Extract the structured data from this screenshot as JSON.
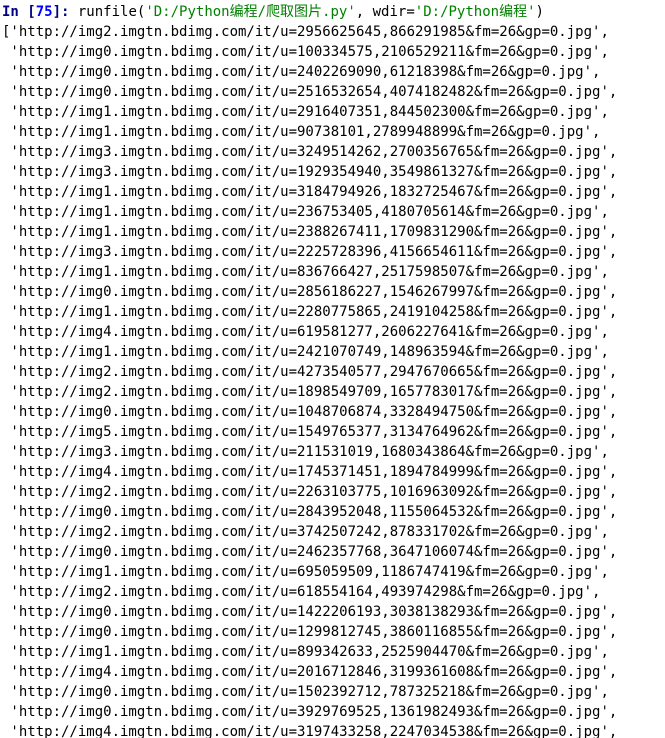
{
  "prompt": {
    "in_label_prefix": "In [",
    "in_number": "75",
    "in_label_suffix": "]: ",
    "func_name": "runfile",
    "open_paren": "(",
    "arg1": "'D:/Python编程/爬取图片.py'",
    "comma": ", ",
    "kwarg_name": "wdir",
    "equals": "=",
    "kwarg_val": "'D:/Python编程'",
    "close_paren": ")"
  },
  "urls": [
    "http://img2.imgtn.bdimg.com/it/u=2956625645,866291985&fm=26&gp=0.jpg",
    "http://img0.imgtn.bdimg.com/it/u=100334575,2106529211&fm=26&gp=0.jpg",
    "http://img0.imgtn.bdimg.com/it/u=2402269090,61218398&fm=26&gp=0.jpg",
    "http://img0.imgtn.bdimg.com/it/u=2516532654,4074182482&fm=26&gp=0.jpg",
    "http://img1.imgtn.bdimg.com/it/u=2916407351,844502300&fm=26&gp=0.jpg",
    "http://img1.imgtn.bdimg.com/it/u=90738101,2789948899&fm=26&gp=0.jpg",
    "http://img3.imgtn.bdimg.com/it/u=3249514262,2700356765&fm=26&gp=0.jpg",
    "http://img3.imgtn.bdimg.com/it/u=1929354940,3549861327&fm=26&gp=0.jpg",
    "http://img1.imgtn.bdimg.com/it/u=3184794926,1832725467&fm=26&gp=0.jpg",
    "http://img1.imgtn.bdimg.com/it/u=236753405,4180705614&fm=26&gp=0.jpg",
    "http://img1.imgtn.bdimg.com/it/u=2388267411,1709831290&fm=26&gp=0.jpg",
    "http://img3.imgtn.bdimg.com/it/u=2225728396,4156654611&fm=26&gp=0.jpg",
    "http://img1.imgtn.bdimg.com/it/u=836766427,2517598507&fm=26&gp=0.jpg",
    "http://img0.imgtn.bdimg.com/it/u=2856186227,1546267997&fm=26&gp=0.jpg",
    "http://img1.imgtn.bdimg.com/it/u=2280775865,2419104258&fm=26&gp=0.jpg",
    "http://img4.imgtn.bdimg.com/it/u=619581277,2606227641&fm=26&gp=0.jpg",
    "http://img1.imgtn.bdimg.com/it/u=2421070749,148963594&fm=26&gp=0.jpg",
    "http://img2.imgtn.bdimg.com/it/u=4273540577,2947670665&fm=26&gp=0.jpg",
    "http://img2.imgtn.bdimg.com/it/u=1898549709,1657783017&fm=26&gp=0.jpg",
    "http://img0.imgtn.bdimg.com/it/u=1048706874,3328494750&fm=26&gp=0.jpg",
    "http://img5.imgtn.bdimg.com/it/u=1549765377,3134764962&fm=26&gp=0.jpg",
    "http://img3.imgtn.bdimg.com/it/u=211531019,1680343864&fm=26&gp=0.jpg",
    "http://img4.imgtn.bdimg.com/it/u=1745371451,1894784999&fm=26&gp=0.jpg",
    "http://img2.imgtn.bdimg.com/it/u=2263103775,1016963092&fm=26&gp=0.jpg",
    "http://img0.imgtn.bdimg.com/it/u=2843952048,1155064532&fm=26&gp=0.jpg",
    "http://img2.imgtn.bdimg.com/it/u=3742507242,878331702&fm=26&gp=0.jpg",
    "http://img0.imgtn.bdimg.com/it/u=2462357768,3647106074&fm=26&gp=0.jpg",
    "http://img1.imgtn.bdimg.com/it/u=695059509,1186747419&fm=26&gp=0.jpg",
    "http://img2.imgtn.bdimg.com/it/u=618554164,493974298&fm=26&gp=0.jpg",
    "http://img0.imgtn.bdimg.com/it/u=1422206193,3038138293&fm=26&gp=0.jpg",
    "http://img0.imgtn.bdimg.com/it/u=1299812745,3860116855&fm=26&gp=0.jpg",
    "http://img1.imgtn.bdimg.com/it/u=899342633,2525904470&fm=26&gp=0.jpg",
    "http://img4.imgtn.bdimg.com/it/u=2016712846,3199361608&fm=26&gp=0.jpg",
    "http://img0.imgtn.bdimg.com/it/u=1502392712,787325218&fm=26&gp=0.jpg",
    "http://img0.imgtn.bdimg.com/it/u=3929769525,1361982493&fm=26&gp=0.jpg",
    "http://img4.imgtn.bdimg.com/it/u=3197433258,2247034538&fm=26&gp=0.jpg"
  ],
  "watermark": ""
}
